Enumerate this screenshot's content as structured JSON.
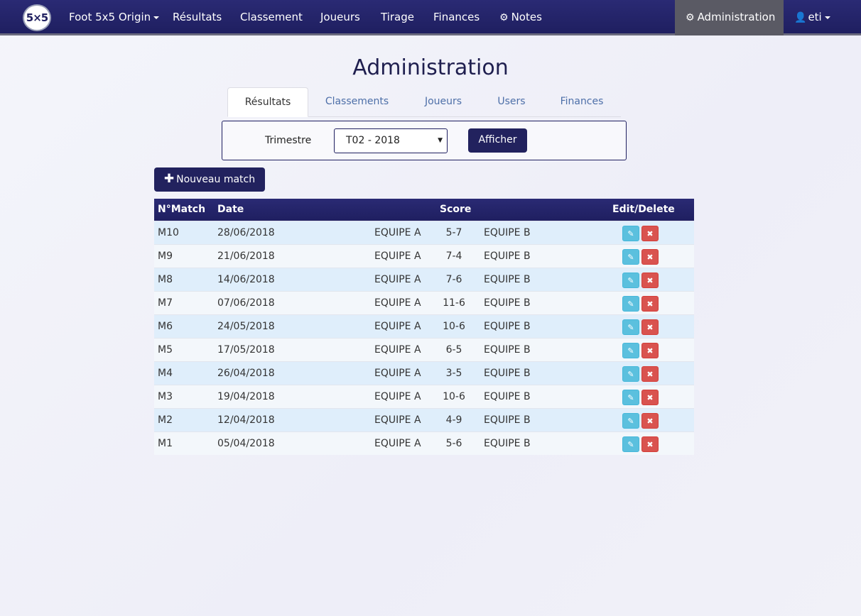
{
  "navbar": {
    "logo_text": "5×5",
    "brand": "Foot 5x5 Origin",
    "items": [
      "Résultats",
      "Classement",
      "Joueurs",
      "Tirage",
      "Finances"
    ],
    "notes": "Notes",
    "admin": "Administration",
    "user": "eti"
  },
  "page": {
    "title": "Administration"
  },
  "tabs": [
    "Résultats",
    "Classements",
    "Joueurs",
    "Users",
    "Finances"
  ],
  "filter": {
    "label": "Trimestre",
    "selected": "T02 - 2018",
    "button": "Afficher"
  },
  "new_match_button": "Nouveau match",
  "table": {
    "headers": {
      "num": "N°Match",
      "date": "Date",
      "score": "Score",
      "actions": "Edit/Delete"
    },
    "rows": [
      {
        "num": "M10",
        "date": "28/06/2018",
        "teamA": "EQUIPE A",
        "score": "5-7",
        "teamB": "EQUIPE B"
      },
      {
        "num": "M9",
        "date": "21/06/2018",
        "teamA": "EQUIPE A",
        "score": "7-4",
        "teamB": "EQUIPE B"
      },
      {
        "num": "M8",
        "date": "14/06/2018",
        "teamA": "EQUIPE A",
        "score": "7-6",
        "teamB": "EQUIPE B"
      },
      {
        "num": "M7",
        "date": "07/06/2018",
        "teamA": "EQUIPE A",
        "score": "11-6",
        "teamB": "EQUIPE B"
      },
      {
        "num": "M6",
        "date": "24/05/2018",
        "teamA": "EQUIPE A",
        "score": "10-6",
        "teamB": "EQUIPE B"
      },
      {
        "num": "M5",
        "date": "17/05/2018",
        "teamA": "EQUIPE A",
        "score": "6-5",
        "teamB": "EQUIPE B"
      },
      {
        "num": "M4",
        "date": "26/04/2018",
        "teamA": "EQUIPE A",
        "score": "3-5",
        "teamB": "EQUIPE B"
      },
      {
        "num": "M3",
        "date": "19/04/2018",
        "teamA": "EQUIPE A",
        "score": "10-6",
        "teamB": "EQUIPE B"
      },
      {
        "num": "M2",
        "date": "12/04/2018",
        "teamA": "EQUIPE A",
        "score": "4-9",
        "teamB": "EQUIPE B"
      },
      {
        "num": "M1",
        "date": "05/04/2018",
        "teamA": "EQUIPE A",
        "score": "5-6",
        "teamB": "EQUIPE B"
      }
    ]
  },
  "icons": {
    "edit": "edit-icon",
    "delete": "delete-icon",
    "gear": "gear-icon",
    "user": "user-icon",
    "plus": "plus-icon"
  },
  "colors": {
    "navbar": "#22225e",
    "admin_active": "#5a5a64",
    "primary_button": "#22225e",
    "edit_button": "#5bc0de",
    "delete_button": "#d9534f",
    "row_odd": "#dfeefb",
    "row_even": "#f3f7fb"
  }
}
